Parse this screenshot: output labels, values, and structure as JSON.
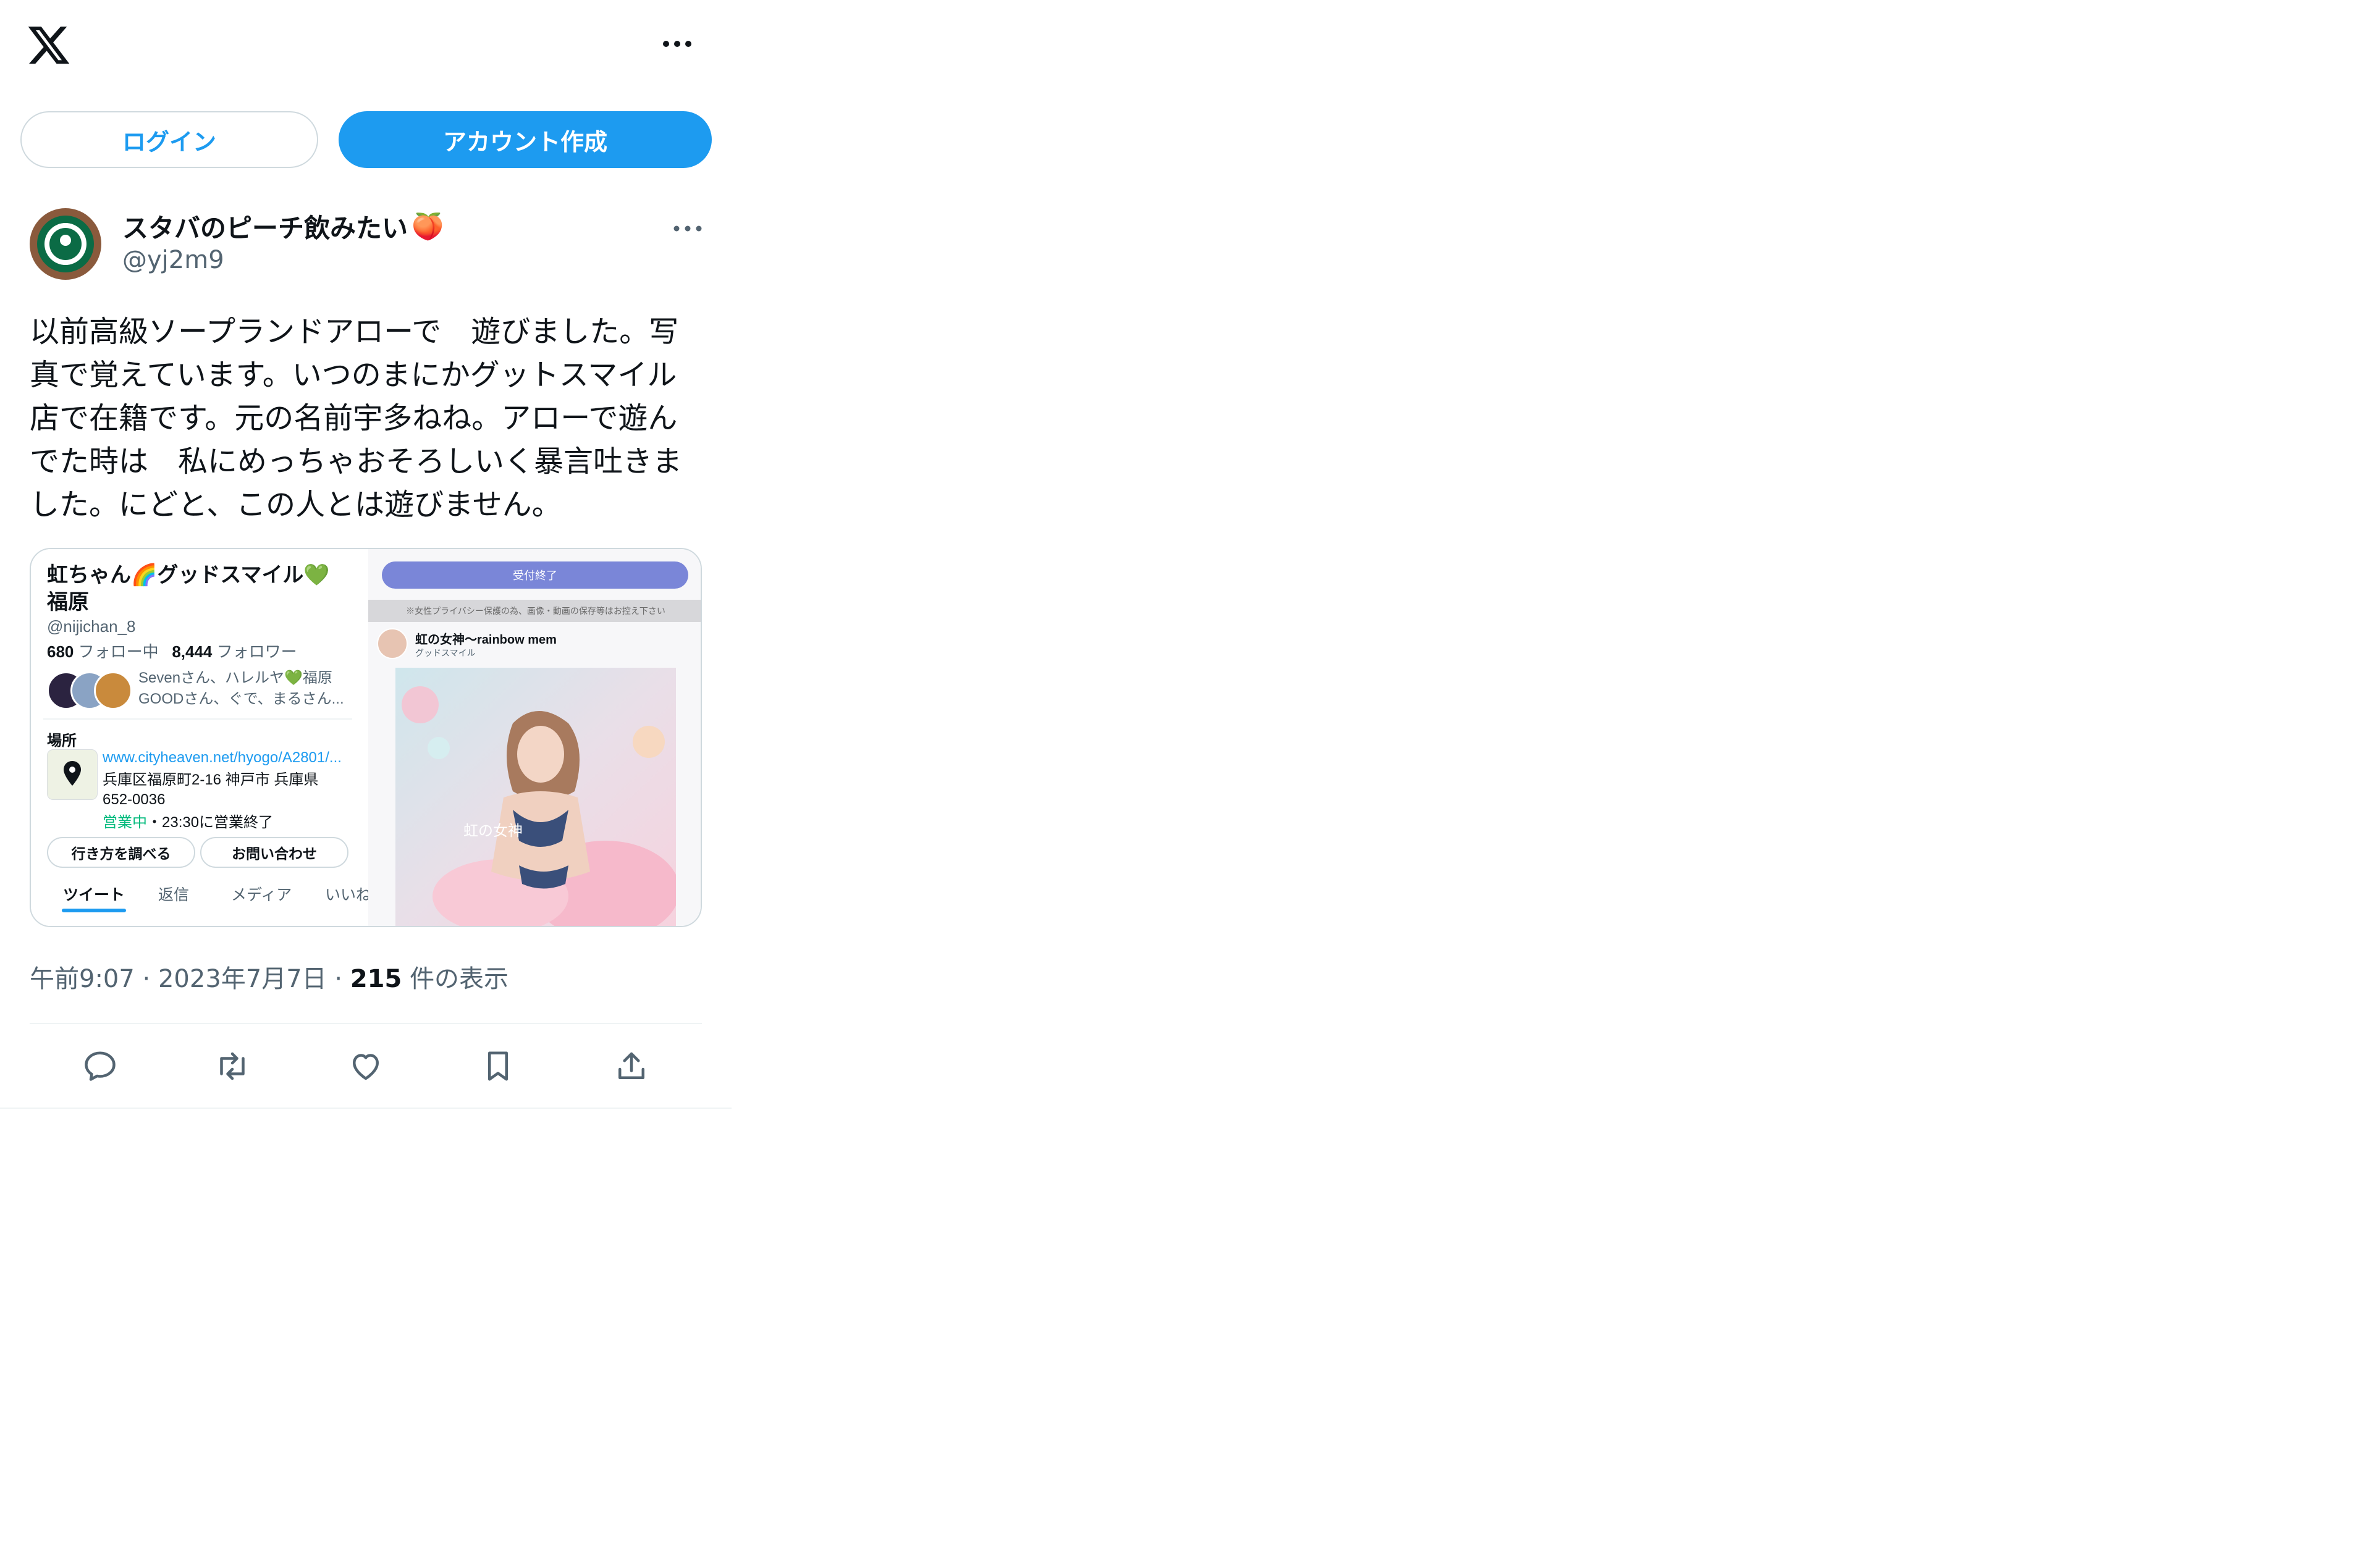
{
  "header": {
    "logo_icon": "x-logo-icon",
    "more_icon": "more-horizontal-icon"
  },
  "auth": {
    "login_label": "ログイン",
    "signup_label": "アカウント作成",
    "accent_color": "#1d9bf0"
  },
  "tweet": {
    "author_name": "スタバのピーチ飲みたい",
    "author_emoji": "🍑",
    "author_handle": "@yj2m9",
    "text": "以前高級ソープランドアローで　遊びました。写\n真で覚えています。いつのまにかグットスマイル\n店で在籍です。元の名前宇多ねね。アローで遊ん\nでた時は　私にめっちゃおそろしいく暴言吐きま\nした。にどと、この人とは遊びません。",
    "time": "午前9:07",
    "sep": "·",
    "date": "2023年7月7日",
    "views_count": "215",
    "views_label": "件の表示"
  },
  "media": {
    "profile_name": "虹ちゃん🌈グッドスマイル💚\n福原",
    "profile_handle": "@nijichan_8",
    "following_count": "680",
    "following_label": "フォロー中",
    "followers_count": "8,444",
    "followers_label": "フォロワー",
    "known_followers": "Sevenさん、ハレルヤ💚福原\nGOODさん、ぐで、まるさん...",
    "place_label": "場所",
    "url": "www.cityheaven.net/hyogo/A2801/...",
    "address": "兵庫区福原町2-16 神戸市 兵庫県\n652-0036",
    "open_status": "営業中",
    "open_hours": "・23:30に営業終了",
    "directions_button": "行き方を調べる",
    "contact_button": "お問い合わせ",
    "tabs": [
      "ツイート",
      "返信",
      "メディア",
      "いいね"
    ],
    "status_pill": "受付終了",
    "privacy_band": "※女性プライバシー保護の為、画像・動画の保存等はお控え下さい",
    "post_title": "虹の女神〜rainbow mem",
    "post_sub": "グッドスマイル",
    "photo_caption": "虹の女神"
  },
  "actions": [
    {
      "icon": "reply-icon"
    },
    {
      "icon": "retweet-icon"
    },
    {
      "icon": "like-icon"
    },
    {
      "icon": "bookmark-icon"
    },
    {
      "icon": "share-icon"
    }
  ]
}
